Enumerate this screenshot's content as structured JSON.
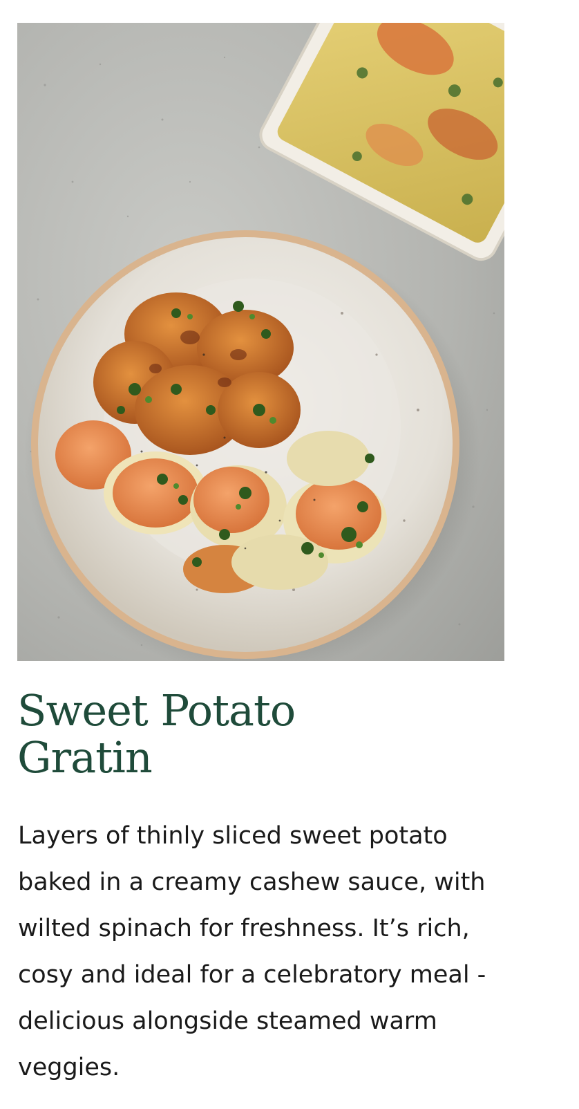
{
  "recipe": {
    "image_subject": "sweet-potato-gratin-photo",
    "title": "Sweet Potato Gratin",
    "description": "Layers of thinly sliced sweet potato baked in a creamy cashew sauce, with wilted spinach for freshness. It’s rich, cosy and ideal for a celebratory meal - delicious alongside steamed warm veggies."
  },
  "colors": {
    "title": "#1f4b3a",
    "body_text": "#1a1a1a",
    "background": "#ffffff"
  }
}
